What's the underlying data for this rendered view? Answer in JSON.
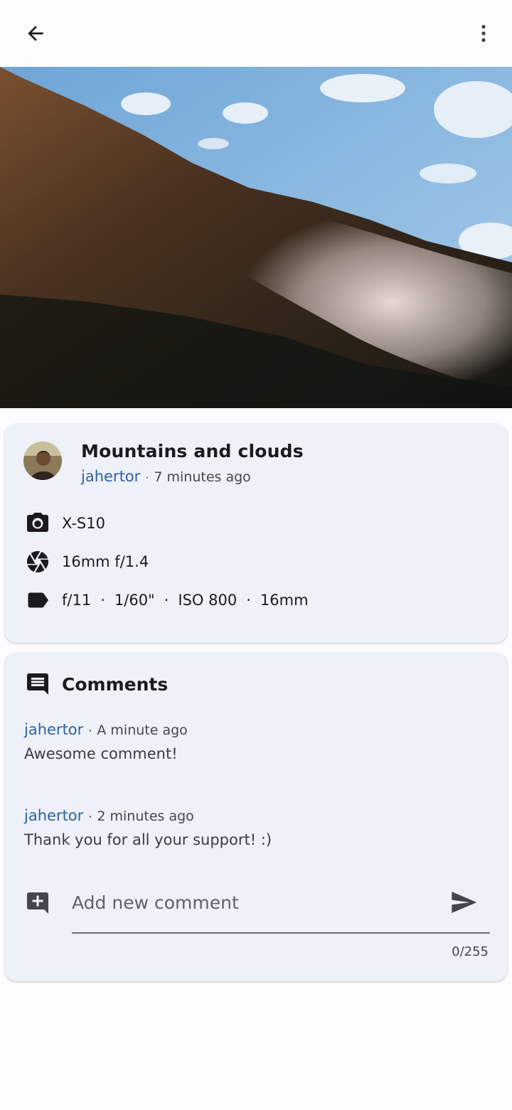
{
  "toolbar": {
    "back_icon": "arrow-back-icon",
    "menu_icon": "more-vert-icon"
  },
  "photo": {
    "alt": "mountain-photo"
  },
  "post": {
    "title": "Mountains and clouds",
    "author": "jahertor",
    "separator": "·",
    "time": "7 minutes ago",
    "camera": "X-S10",
    "lens": "16mm f/1.4",
    "settings": [
      "f/11",
      "1/60\"",
      "ISO 800",
      "16mm"
    ],
    "settings_separator": "·"
  },
  "comments": {
    "title": "Comments",
    "items": [
      {
        "author": "jahertor",
        "time": "A minute ago",
        "text": "Awesome comment!"
      },
      {
        "author": "jahertor",
        "time": "2 minutes ago",
        "text": "Thank you for all your support! :)"
      }
    ],
    "input_placeholder": "Add new comment",
    "input_value": "",
    "counter": "0/255"
  },
  "colors": {
    "background": "#fcfcfe",
    "card": "#eff1f9",
    "link": "#2b62a2",
    "text": "#1b1b1f"
  }
}
